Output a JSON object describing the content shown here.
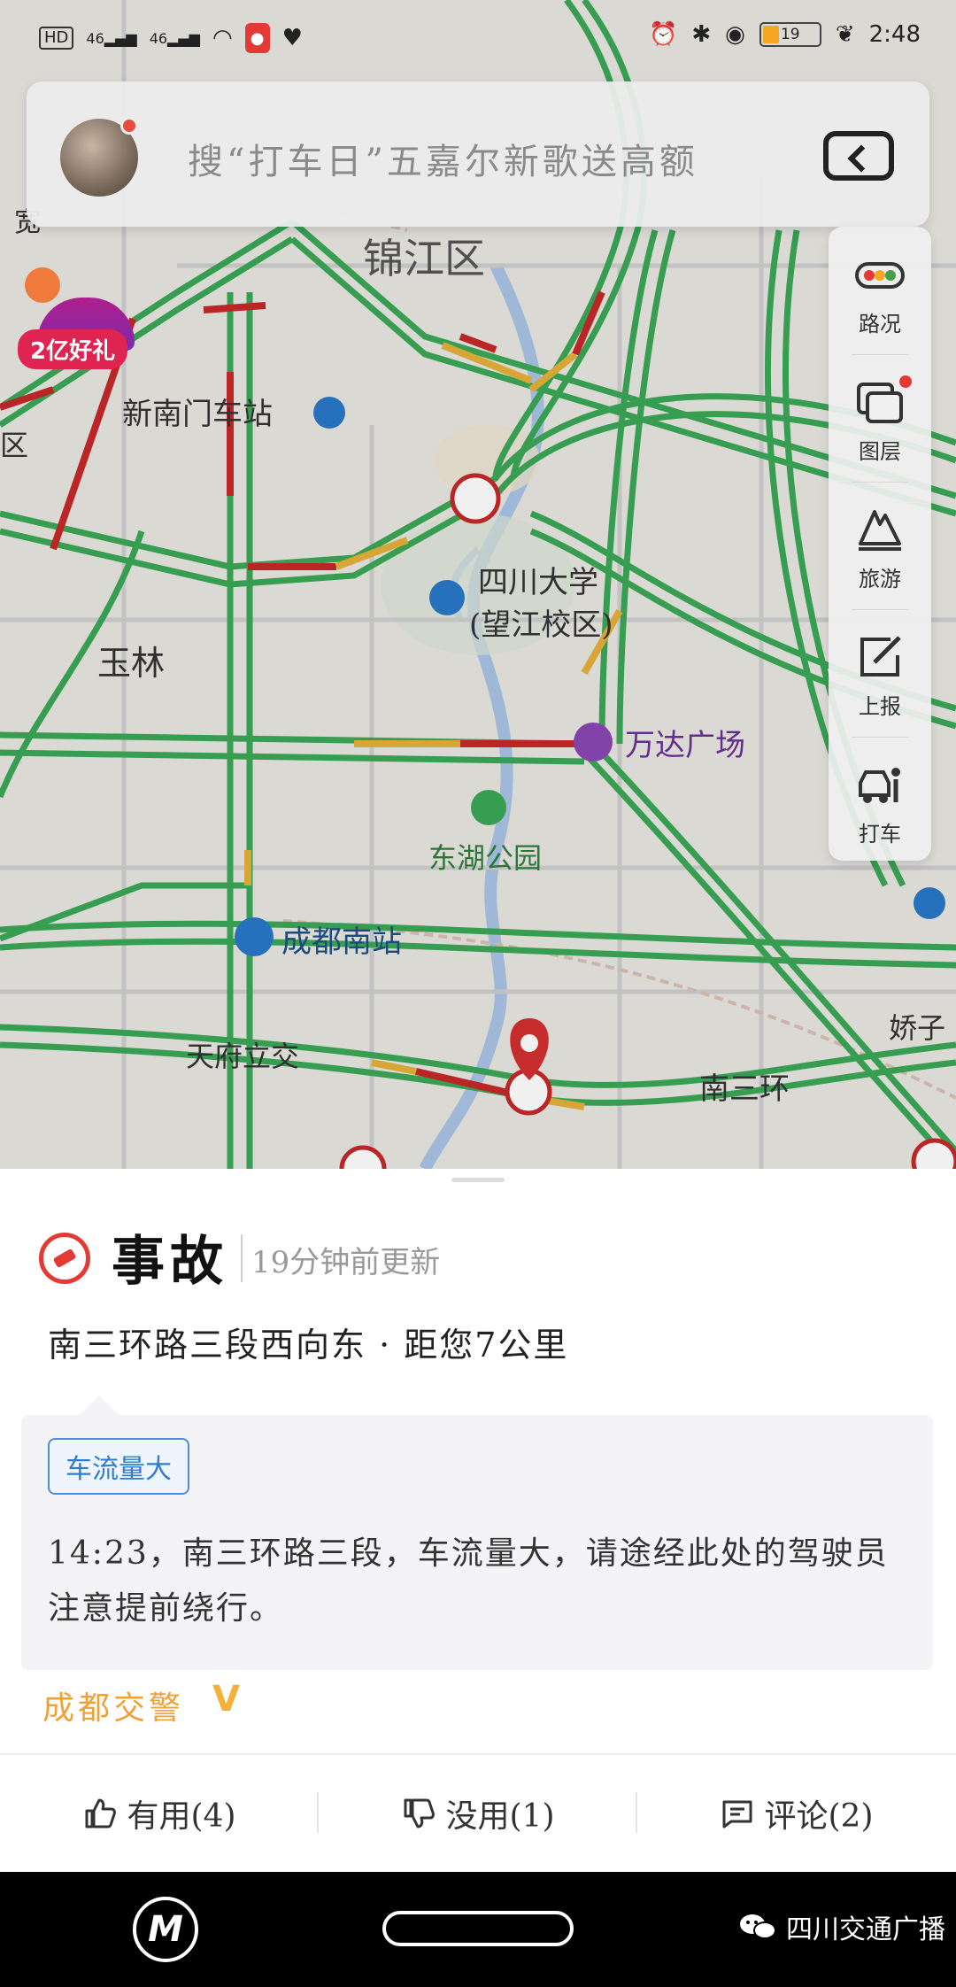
{
  "status_bar": {
    "network": "HD",
    "signal_1": "46",
    "signal_2": "46",
    "battery": "19",
    "time": "2:48",
    "icons": [
      "signal-icon",
      "wifi-icon",
      "mic-icon",
      "heart-icon",
      "alarm-icon",
      "bluetooth-icon",
      "location-icon",
      "battery-icon",
      "leaf-icon"
    ]
  },
  "search": {
    "placeholder": "搜“打车日”五嘉尔新歌送高额"
  },
  "promo": {
    "label": "2亿好礼"
  },
  "map": {
    "labels": {
      "jinjiang": "锦江区",
      "xinnanmen": "新南门车站",
      "yulin": "玉林",
      "sichuan_univ_1": "四川大学",
      "sichuan_univ_2": "(望江校区)",
      "wanda": "万达广场",
      "donghu": "东湖公园",
      "chengdu_south": "成都南站",
      "tianfu": "天府立交",
      "nansanhuan": "南三环",
      "jiaozi": "娇子",
      "edge_left_top": "宽",
      "edge_left": "区"
    }
  },
  "toolbar": {
    "items": [
      {
        "label": "路况",
        "icon": "traffic-light-icon"
      },
      {
        "label": "图层",
        "icon": "layers-icon"
      },
      {
        "label": "旅游",
        "icon": "travel-icon"
      },
      {
        "label": "上报",
        "icon": "report-icon"
      },
      {
        "label": "打车",
        "icon": "taxi-icon"
      }
    ]
  },
  "event": {
    "title": "事故",
    "updated": "19分钟前更新",
    "location": "南三环路三段西向东 · 距您7公里",
    "tag": "车流量大",
    "description": "14:23，南三环路三段，车流量大，请途经此处的驾驶员注意提前绕行。",
    "source": "成都交警",
    "verified_mark": "V"
  },
  "actions": {
    "useful": "有用(4)",
    "useless": "没用(1)",
    "comment": "评论(2)"
  },
  "watermark": {
    "text": "四川交通广播"
  },
  "colors": {
    "road_green": "#3aa757",
    "road_yellow": "#e6b13a",
    "road_red": "#c62828",
    "accent_blue": "#2f7bd0",
    "source_orange": "#f0a136"
  }
}
